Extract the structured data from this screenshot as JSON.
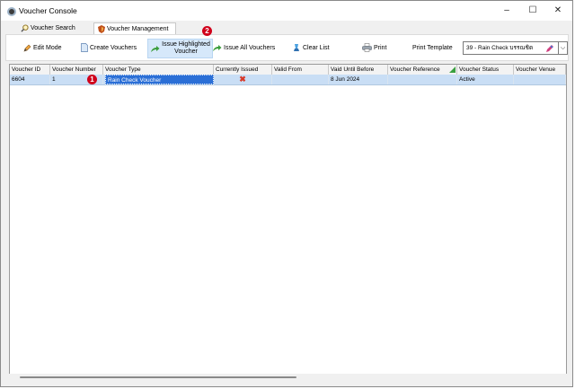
{
  "window": {
    "title": "Voucher Console",
    "controls": {
      "minimize": "–",
      "maximize": "☐",
      "close": "✕"
    }
  },
  "tabs": [
    {
      "label": "Voucher Search",
      "icon": "magnifier-icon",
      "active": false
    },
    {
      "label": "Voucher Management",
      "icon": "voucher-shield-icon",
      "active": true
    }
  ],
  "toolbar": {
    "edit_mode": "Edit Mode",
    "create_vouchers": "Create Vouchers",
    "issue_highlighted": "Issue Highlighted Voucher",
    "issue_all": "Issue All Vouchers",
    "clear_list": "Clear List",
    "print": "Print",
    "print_template_label": "Print Template",
    "print_template_value": "39 - Rain Check บรรณชิด"
  },
  "grid": {
    "columns": [
      "Voucher ID",
      "Voucher Number",
      "Voucher Type",
      "Currently Issued",
      "Valid From",
      "Vaid Until Before",
      "Voucher Reference",
      "Voucher Status",
      "Voucher Venue"
    ],
    "rows": [
      {
        "voucher_id": "6604",
        "voucher_number": "1",
        "voucher_type": "Rain Check Voucher",
        "currently_issued": "✖",
        "valid_from": "",
        "valid_until_before": "8 Jun 2024",
        "voucher_reference": "",
        "voucher_status": "Active",
        "voucher_venue": ""
      }
    ]
  },
  "annotations": [
    "1",
    "2"
  ],
  "colors": {
    "selection": "#2b6fd6",
    "row_highlight": "#c9def5",
    "button_highlight": "#d6e8fa",
    "badge": "#d0021b",
    "issued_x": "#d83a2a"
  }
}
